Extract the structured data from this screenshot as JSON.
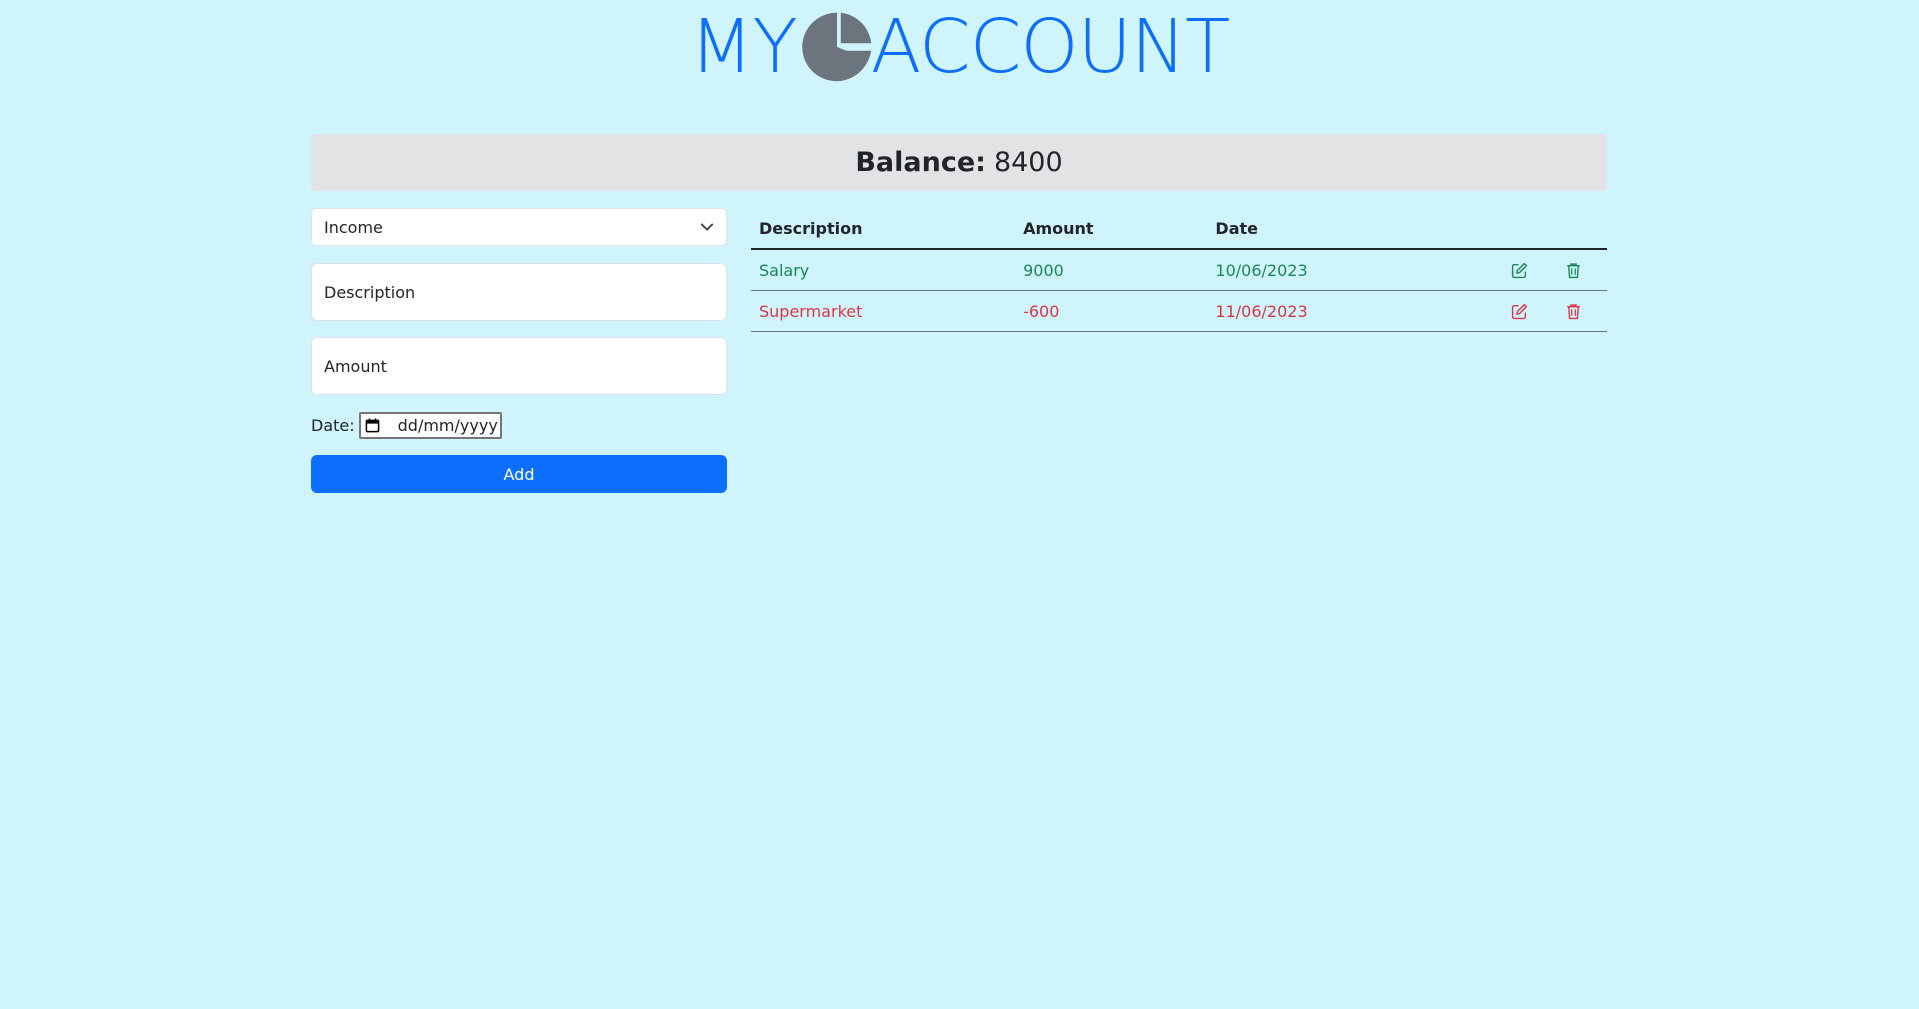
{
  "header": {
    "logo_left": "MY",
    "logo_right": "ACCOUNT"
  },
  "balance": {
    "label": "Balance:",
    "value": "8400"
  },
  "form": {
    "type_select": {
      "selected": "Income"
    },
    "description_placeholder": "Description",
    "amount_placeholder": "Amount",
    "date_label": "Date:",
    "date_placeholder": "dd/mm/yyyy",
    "add_label": "Add"
  },
  "table": {
    "headers": [
      "Description",
      "Amount",
      "Date"
    ],
    "rows": [
      {
        "description": "Salary",
        "amount": "9000",
        "date": "10/06/2023",
        "kind": "income"
      },
      {
        "description": "Supermarket",
        "amount": "-600",
        "date": "11/06/2023",
        "kind": "expense"
      }
    ]
  },
  "colors": {
    "background": "#cff4fc",
    "accent": "#0d6efd",
    "income": "#198754",
    "expense": "#dc3545",
    "logo_icon": "#6c757d"
  },
  "icons": {
    "logo": "pie-chart-icon",
    "select": "chevron-down-icon",
    "date": "calendar-icon",
    "edit": "edit-icon",
    "delete": "trash-icon"
  }
}
